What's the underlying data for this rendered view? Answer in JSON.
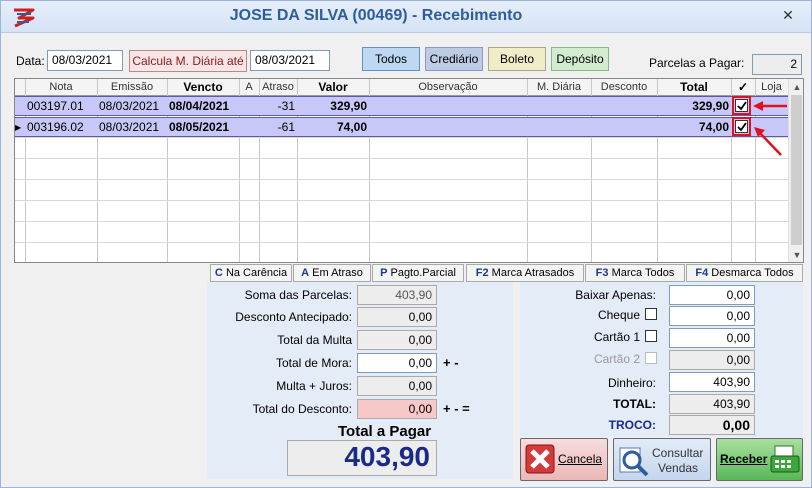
{
  "window": {
    "title": "JOSE DA SILVA (00469) - Recebimento",
    "close_glyph": "✕"
  },
  "header": {
    "data_label": "Data:",
    "data_value": "08/03/2021",
    "calc_button": "Calcula M. Diária até",
    "calc_date": "08/03/2021",
    "filters": [
      "Todos",
      "Crediário",
      "Boleto",
      "Depósito"
    ],
    "parcelas_label": "Parcelas a Pagar:",
    "parcelas_value": "2"
  },
  "grid": {
    "columns": [
      "Nota",
      "Emissão",
      "Vencto",
      "A",
      "Atraso",
      "Valor",
      "Observação",
      "M. Diária",
      "Desconto",
      "Total",
      "✓",
      "Loja"
    ],
    "rows": [
      {
        "nota": "003197.01",
        "emissao": "08/03/2021",
        "vencto": "08/04/2021",
        "atraso": "-31",
        "valor": "329,90",
        "total": "329,90",
        "checked": true
      },
      {
        "nota": "003196.02",
        "emissao": "08/03/2021",
        "vencto": "08/05/2021",
        "atraso": "-61",
        "valor": "74,00",
        "total": "74,00",
        "checked": true
      }
    ]
  },
  "shortcuts": [
    {
      "key": "C",
      "label": "Na Carência"
    },
    {
      "key": "A",
      "label": "Em Atraso"
    },
    {
      "key": "P",
      "label": "Pagto.Parcial"
    },
    {
      "key": "F2",
      "label": "Marca Atrasados"
    },
    {
      "key": "F3",
      "label": "Marca Todos"
    },
    {
      "key": "F4",
      "label": "Desmarca Todos"
    }
  ],
  "totals": {
    "soma_label": "Soma das Parcelas:",
    "soma_value": "403,90",
    "desc_ant_label": "Desconto Antecipado:",
    "desc_ant_value": "0,00",
    "multa_label": "Total da Multa",
    "multa_value": "0,00",
    "mora_label": "Total de Mora:",
    "mora_value": "0,00",
    "mora_ops": "+ -",
    "mj_label": "Multa + Juros:",
    "mj_value": "0,00",
    "tdesc_label": "Total do Desconto:",
    "tdesc_value": "0,00",
    "tdesc_ops": "+ - =",
    "pagar_label": "Total a Pagar",
    "pagar_value": "403,90"
  },
  "payment": {
    "baixar_label": "Baixar Apenas:",
    "baixar_value": "0,00",
    "cheque_label": "Cheque",
    "cheque_value": "0,00",
    "cartao1_label": "Cartão 1",
    "cartao1_value": "0,00",
    "cartao2_label": "Cartão 2",
    "cartao2_value": "0,00",
    "dinheiro_label": "Dinheiro:",
    "dinheiro_value": "403,90",
    "total_label": "TOTAL:",
    "total_value": "403,90",
    "troco_label": "TROCO:",
    "troco_value": "0,00"
  },
  "actions": {
    "cancel": "Cancela",
    "consult_1": "Consultar",
    "consult_2": "Vendas",
    "receive": "Receber"
  },
  "colors": {
    "title": "#2e5d9f",
    "selected_row": "#c8c8f8",
    "highlight": "#e0101e",
    "panel": "#e3ecf7",
    "big_total": "#1a2a8a"
  }
}
